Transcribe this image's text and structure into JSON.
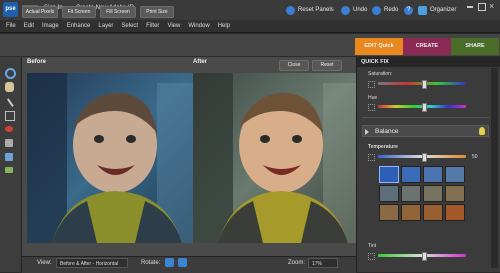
{
  "topbar": {
    "logo": "pse",
    "sign_in": "Sign In",
    "create_id": "Create New Adobe ID",
    "reset_panels": "Reset Panels",
    "undo": "Undo",
    "redo": "Redo",
    "organizer": "Organizer"
  },
  "menu": [
    "File",
    "Edit",
    "Image",
    "Enhance",
    "Layer",
    "Select",
    "Filter",
    "View",
    "Window",
    "Help"
  ],
  "options": {
    "actual_pixels": "Actual Pixels",
    "fit_screen": "Fit Screen",
    "fill_screen": "Fill Screen",
    "print_size": "Print Size"
  },
  "modes": {
    "edit_quick": "EDIT Quick",
    "create": "CREATE",
    "share": "SHARE"
  },
  "workspace": {
    "before_label": "Before",
    "after_label": "After",
    "close": "Close",
    "reset": "Reset"
  },
  "bottombar": {
    "view_label": "View:",
    "view_value": "Before & After - Horizontal",
    "rotate_label": "Rotate:",
    "zoom_label": "Zoom:",
    "zoom_value": "17%"
  },
  "quickfix": {
    "header": "QUICK FIX",
    "saturation_label": "Saturation:",
    "hue_label": "Hue",
    "balance_header": "Balance",
    "temperature_label": "Temperature",
    "temperature_value": "50",
    "tint_label": "Tint"
  },
  "colors": {
    "edit_tab": "#e8881f",
    "create_tab": "#8a2a55",
    "share_tab": "#4a6e2a"
  }
}
